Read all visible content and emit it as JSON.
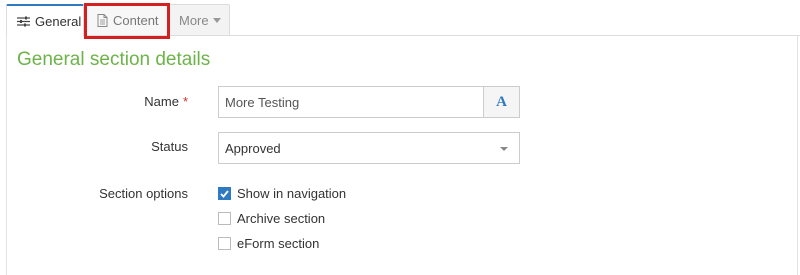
{
  "tabs": [
    {
      "label": "General",
      "icon": "sliders-icon",
      "active": true
    },
    {
      "label": "Content",
      "icon": "document-icon",
      "highlighted": true
    },
    {
      "label": "More",
      "icon": "caret-down-icon"
    }
  ],
  "section": {
    "title": "General section details"
  },
  "form": {
    "name": {
      "label": "Name",
      "required_mark": "*",
      "value": "More Testing",
      "addon_label": "A"
    },
    "status": {
      "label": "Status",
      "value": "Approved"
    },
    "options": {
      "label": "Section options",
      "items": [
        {
          "label": "Show in navigation",
          "checked": true
        },
        {
          "label": "Archive section",
          "checked": false
        },
        {
          "label": "eForm section",
          "checked": false
        }
      ]
    }
  },
  "colors": {
    "accent": "#2f79c1",
    "title_green": "#6cb44a",
    "required_red": "#c9302c",
    "highlight_red": "#d32020"
  }
}
